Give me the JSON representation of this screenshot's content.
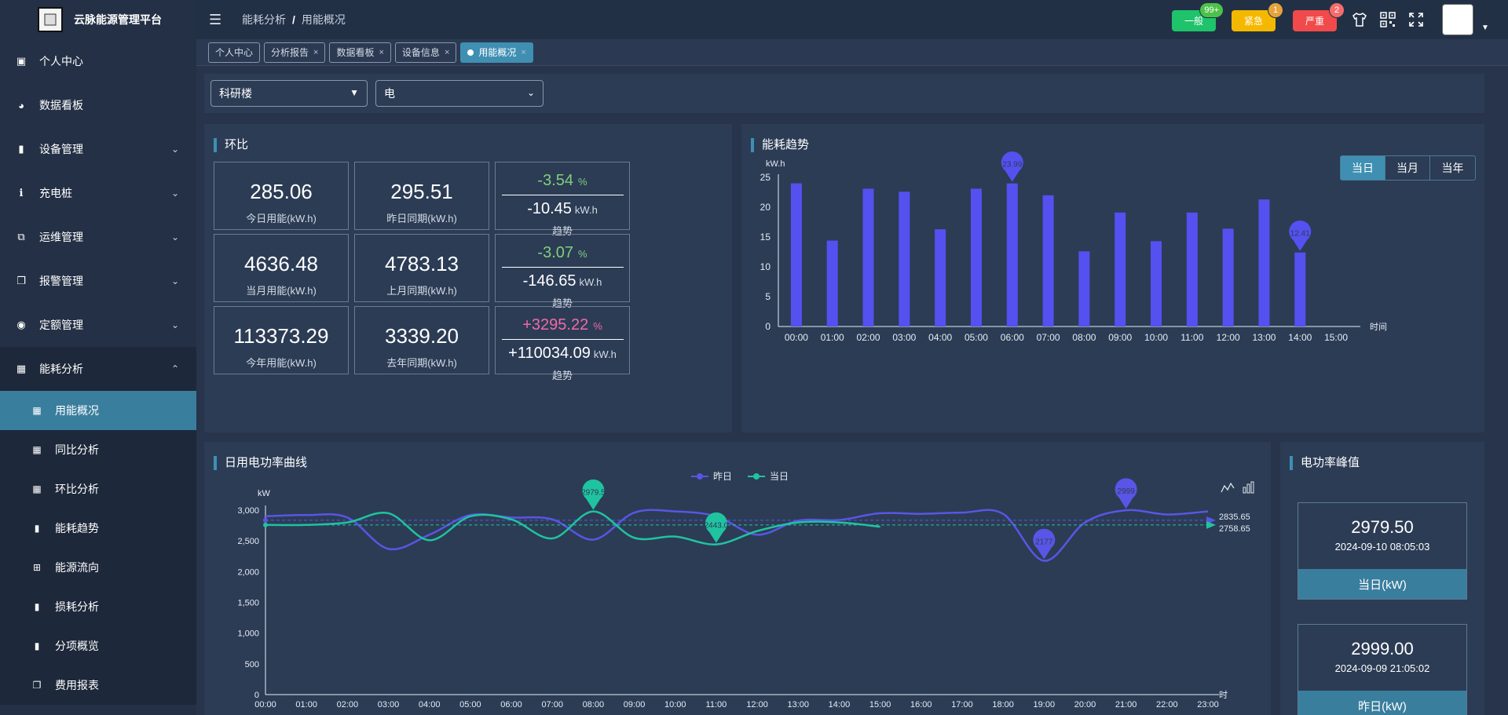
{
  "brand": {
    "title": "云脉能源管理平台"
  },
  "sidebar": {
    "items": [
      {
        "label": "个人中心",
        "icon": "dashboard-icon",
        "chevron": false
      },
      {
        "label": "数据看板",
        "icon": "gauge-icon",
        "chevron": false
      },
      {
        "label": "设备管理",
        "icon": "bar-chart-icon",
        "chevron": true
      },
      {
        "label": "充电桩",
        "icon": "info-icon",
        "chevron": true
      },
      {
        "label": "运维管理",
        "icon": "puzzle-icon",
        "chevron": true
      },
      {
        "label": "报警管理",
        "icon": "copy-icon",
        "chevron": true
      },
      {
        "label": "定额管理",
        "icon": "circle-dot-icon",
        "chevron": true
      }
    ],
    "open_group": {
      "label": "能耗分析",
      "icon": "table-icon",
      "children": [
        {
          "label": "用能概况",
          "icon": "table-icon",
          "active": true
        },
        {
          "label": "同比分析",
          "icon": "table-icon",
          "active": false
        },
        {
          "label": "环比分析",
          "icon": "table-icon",
          "active": false
        },
        {
          "label": "能耗趋势",
          "icon": "bar-chart-icon",
          "active": false
        },
        {
          "label": "能源流向",
          "icon": "sitemap-icon",
          "active": false
        },
        {
          "label": "损耗分析",
          "icon": "bar-chart-icon",
          "active": false
        },
        {
          "label": "分项概览",
          "icon": "bar-chart-icon",
          "active": false
        },
        {
          "label": "费用报表",
          "icon": "copy-icon",
          "active": false
        }
      ]
    }
  },
  "header": {
    "breadcrumb": [
      "能耗分析",
      "用能概况"
    ],
    "breadcrumb_sep": "/",
    "alarms": [
      {
        "label": "一般",
        "count": "99+",
        "color": "#1fc36b",
        "badge_color": "#4cc24a"
      },
      {
        "label": "紧急",
        "count": "1",
        "color": "#f5b800",
        "badge_color": "#e6a23c"
      },
      {
        "label": "严重",
        "count": "2",
        "color": "#f04a4a",
        "badge_color": "#f56c6c"
      }
    ]
  },
  "tabs": [
    {
      "label": "个人中心",
      "closable": false,
      "active": false
    },
    {
      "label": "分析报告",
      "closable": true,
      "active": false
    },
    {
      "label": "数据看板",
      "closable": true,
      "active": false
    },
    {
      "label": "设备信息",
      "closable": true,
      "active": false
    },
    {
      "label": "用能概况",
      "closable": true,
      "active": true
    }
  ],
  "filters": {
    "building": "科研楼",
    "energy_type": "电"
  },
  "compare_panel": {
    "title": "环比",
    "rows": [
      {
        "current": "285.06",
        "current_label": "今日用能(kW.h)",
        "previous": "295.51",
        "previous_label": "昨日同期(kW.h)",
        "pct": "-3.54",
        "pct_color": "#7fd07a",
        "abs": "-10.45",
        "trend_label": "趋势"
      },
      {
        "current": "4636.48",
        "current_label": "当月用能(kW.h)",
        "previous": "4783.13",
        "previous_label": "上月同期(kW.h)",
        "pct": "-3.07",
        "pct_color": "#7fd07a",
        "abs": "-146.65",
        "trend_label": "趋势"
      },
      {
        "current": "113373.29",
        "current_label": "今年用能(kW.h)",
        "previous": "3339.20",
        "previous_label": "去年同期(kW.h)",
        "pct": "+3295.22",
        "pct_color": "#f06aa6",
        "abs": "+110034.09",
        "trend_label": "趋势"
      }
    ],
    "pct_unit": "%",
    "abs_unit": "kW.h"
  },
  "trend_panel": {
    "title": "能耗趋势",
    "ranges": [
      "当日",
      "当月",
      "当年"
    ],
    "active_range": "当日"
  },
  "power_panel": {
    "title": "日用电功率曲线"
  },
  "peak_panel": {
    "title": "电功率峰值",
    "cards": [
      {
        "value": "2979.50",
        "time": "2024-09-10 08:05:03",
        "label": "当日(kW)"
      },
      {
        "value": "2999.00",
        "time": "2024-09-09 21:05:02",
        "label": "昨日(kW)"
      }
    ]
  },
  "chart_data": [
    {
      "type": "bar",
      "ylabel": "kW.h",
      "xlabel": "时间",
      "ylim": [
        0,
        25
      ],
      "yticks": [
        0,
        5,
        10,
        15,
        20,
        25
      ],
      "categories": [
        "00:00",
        "01:00",
        "02:00",
        "03:00",
        "04:00",
        "05:00",
        "06:00",
        "07:00",
        "08:00",
        "09:00",
        "10:00",
        "11:00",
        "12:00",
        "13:00",
        "14:00",
        "15:00"
      ],
      "values": [
        24.0,
        14.4,
        23.1,
        22.6,
        16.3,
        23.1,
        23.99,
        22.0,
        12.6,
        19.1,
        14.3,
        19.1,
        16.4,
        21.3,
        12.41,
        null
      ],
      "color": "#5451f0",
      "markers": [
        {
          "category": "06:00",
          "label": "23.99",
          "kind": "max"
        },
        {
          "category": "14:00",
          "label": "12.41",
          "kind": "min"
        }
      ],
      "grid": false
    },
    {
      "type": "line",
      "ylabel": "kW",
      "xlabel": "时",
      "ylim": [
        0,
        3000
      ],
      "yticks": [
        "0",
        "500",
        "1,000",
        "1,500",
        "2,000",
        "2,500",
        "3,000"
      ],
      "x": [
        "00:00",
        "01:00",
        "02:00",
        "03:00",
        "04:00",
        "05:00",
        "06:00",
        "07:00",
        "08:00",
        "09:00",
        "10:00",
        "11:00",
        "12:00",
        "13:00",
        "14:00",
        "15:00",
        "16:00",
        "17:00",
        "18:00",
        "19:00",
        "20:00",
        "21:00",
        "22:00",
        "23:00"
      ],
      "legend": [
        "昨日",
        "当日"
      ],
      "legend_position": "top-center",
      "series": [
        {
          "name": "昨日",
          "color": "#5a55e6",
          "values": [
            2900,
            2920,
            2880,
            2370,
            2600,
            2920,
            2880,
            2850,
            2520,
            2960,
            2980,
            2900,
            2600,
            2830,
            2840,
            2950,
            2940,
            2960,
            2940,
            2177,
            2800,
            2999,
            2930,
            2980
          ],
          "markers": [
            {
              "x": "21:00",
              "label": "2999"
            },
            {
              "x": "19:00",
              "label": "2177"
            }
          ],
          "mean_label": "2835.65"
        },
        {
          "name": "当日",
          "color": "#1fc3a0",
          "values": [
            2760,
            2760,
            2800,
            2950,
            2510,
            2900,
            2850,
            2540,
            2979.5,
            2550,
            2570,
            2443,
            2660,
            2800,
            2800,
            2730
          ],
          "markers": [
            {
              "x": "08:00",
              "label": "2979.5"
            },
            {
              "x": "11:00",
              "label": "2443.0"
            }
          ],
          "mean_label": "2758.65"
        }
      ],
      "grid": false
    }
  ]
}
